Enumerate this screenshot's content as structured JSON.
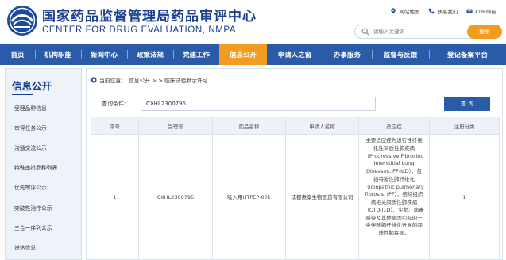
{
  "header": {
    "title_cn": "国家药品监督管理局药品审评中心",
    "title_en": "CENTER FOR DRUG EVALUATION, NMPA",
    "links": {
      "sitemap": "网站地图",
      "contact": "联系我们",
      "email": "CDE邮箱"
    },
    "search": {
      "placeholder": "请输入关键词",
      "button": "搜索"
    }
  },
  "nav": {
    "items": [
      "首页",
      "机构职能",
      "新闻中心",
      "政策法规",
      "党建工作",
      "信息公开",
      "申请人之窗",
      "办事服务",
      "监督与反馈",
      "登记备案平台"
    ],
    "active_index": 5
  },
  "sidebar": {
    "title": "信息公开",
    "items": [
      "受理品种信息",
      "审评任务公示",
      "沟通交流公示",
      "特殊审批品种列表",
      "优先审评公示",
      "突破性治疗公示",
      "三合一序列公示",
      "送达信息"
    ]
  },
  "breadcrumb": {
    "prefix": "当前位置：",
    "path": "信息公开 > > 临床试验默示许可"
  },
  "query": {
    "label": "查询条件:",
    "value": "CXHL2300795",
    "button": "查 询"
  },
  "table": {
    "headers": [
      "序号",
      "受理号",
      "药品名称",
      "申请人名称",
      "适应症",
      "注册分类"
    ],
    "rows": [
      {
        "index": "1",
        "accept_no": "CXHL2300795",
        "drug_name": "吸入用HTPEP-001",
        "applicant": "成都惠泰生物医药有限公司",
        "indication": "主要适应症为进行性纤维化性间质性肺疾病（Progressive Fibrosing Interstitial Lung Diseases, PF-ILD）：包括特发性肺纤维化（idiopathic pulmonary fibrosis, IPF）、结缔组织病相关间质性肺疾病（CTD-ILD）、尘肺、病毒感染及其他病因引起的一类伴随肺纤维化进展的间质性肺疾病。",
        "reg_class": "1"
      }
    ]
  },
  "colors": {
    "primary": "#2a5ba8",
    "brand_text": "#1a3f8f",
    "accent": "#f39c1f",
    "sidebar_bg": "#eef3fa"
  }
}
